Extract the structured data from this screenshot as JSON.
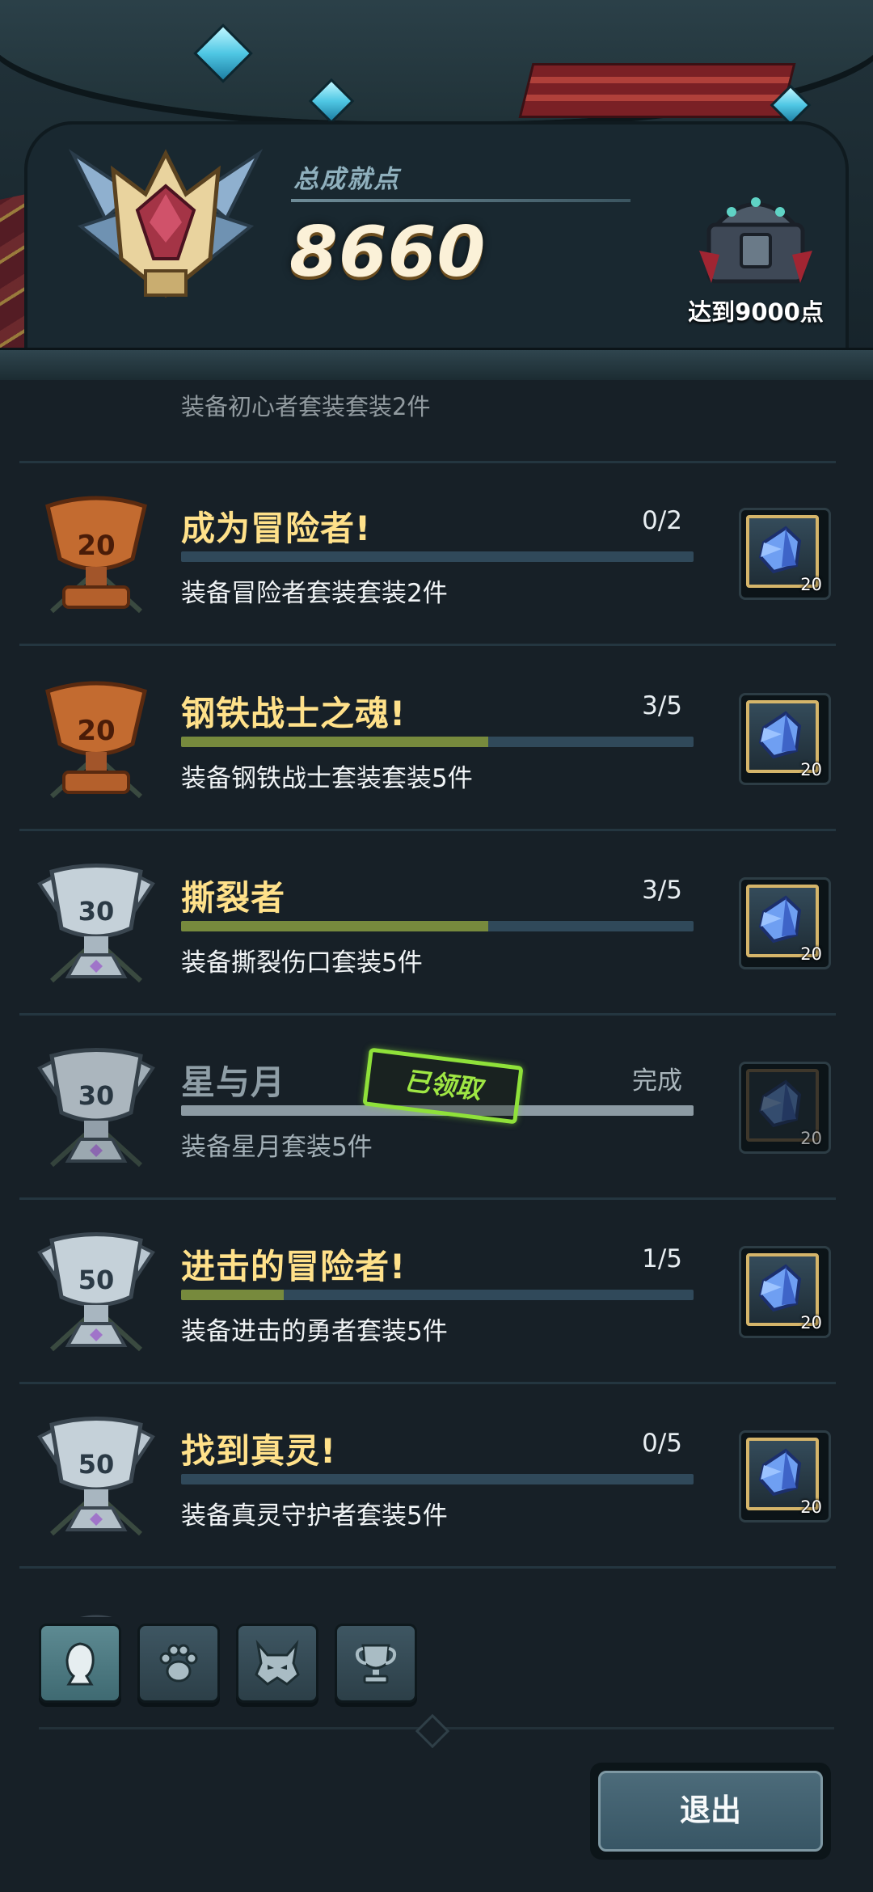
{
  "header": {
    "score_label": "总成就点",
    "score_value": "8660",
    "next_reward_label": "达到9000点"
  },
  "achievements": [
    {
      "title": "成为冒险者!",
      "progress": "0/2",
      "progress_fraction": 0.0,
      "description": "装备冒险者套装套装2件",
      "trophy_number": "20",
      "trophy_tier": "bronze",
      "reward_qty": "20",
      "claimed": false
    },
    {
      "title": "钢铁战士之魂!",
      "progress": "3/5",
      "progress_fraction": 0.6,
      "description": "装备钢铁战士套装套装5件",
      "trophy_number": "20",
      "trophy_tier": "bronze",
      "reward_qty": "20",
      "claimed": false
    },
    {
      "title": "撕裂者",
      "progress": "3/5",
      "progress_fraction": 0.6,
      "description": "装备撕裂伤口套装5件",
      "trophy_number": "30",
      "trophy_tier": "silver",
      "reward_qty": "20",
      "claimed": false
    },
    {
      "title": "星与月",
      "progress": "完成",
      "progress_fraction": 1.0,
      "description": "装备星月套装5件",
      "trophy_number": "30",
      "trophy_tier": "silver",
      "reward_qty": "20",
      "claimed": true,
      "stamp": "已领取"
    },
    {
      "title": "进击的冒险者!",
      "progress": "1/5",
      "progress_fraction": 0.2,
      "description": "装备进击的勇者套装5件",
      "trophy_number": "50",
      "trophy_tier": "silver",
      "reward_qty": "20",
      "claimed": false
    },
    {
      "title": "找到真灵!",
      "progress": "0/5",
      "progress_fraction": 0.0,
      "description": "装备真灵守护者套装5件",
      "trophy_number": "50",
      "trophy_tier": "silver",
      "reward_qty": "20",
      "claimed": false
    }
  ],
  "partial_top_text": "装备初心者套装套装2件",
  "tabs": [
    {
      "icon": "hero-icon",
      "active": true
    },
    {
      "icon": "paw-icon",
      "active": false
    },
    {
      "icon": "demon-icon",
      "active": false
    },
    {
      "icon": "trophy-icon",
      "active": false
    }
  ],
  "exit_label": "退出",
  "colors": {
    "background": "#172027",
    "title_gold": "#ffe18a",
    "progress_fill": "#778a3d",
    "stamp_green": "#8fe13a"
  }
}
